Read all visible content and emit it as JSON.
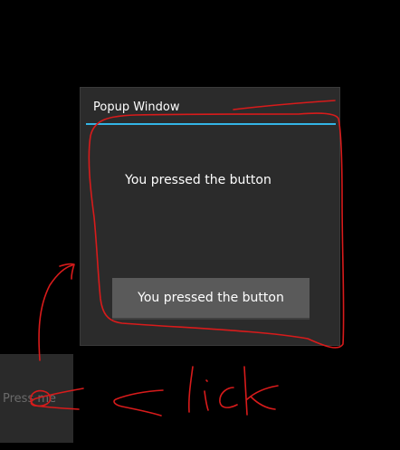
{
  "popup": {
    "title": "Popup Window",
    "message": "You pressed the button",
    "button_label": "You pressed the button"
  },
  "main": {
    "press_button_label": "Press me"
  },
  "annotation": {
    "handwritten_text": "click",
    "color": "#d81b1b"
  },
  "colors": {
    "accent": "#33b5e5",
    "popup_background": "#2b2b2b",
    "button_background": "#5a5a5a",
    "screen_background": "#000000"
  }
}
